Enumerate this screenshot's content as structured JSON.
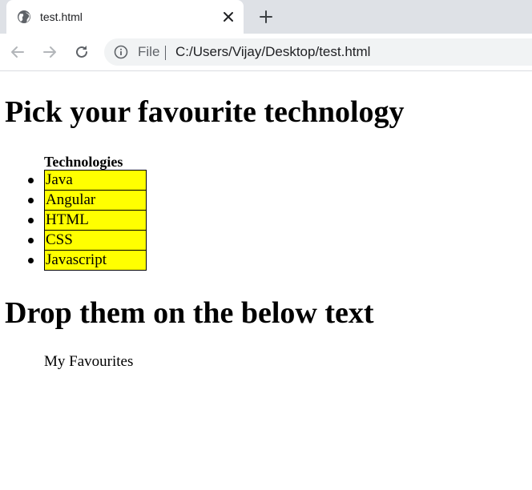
{
  "browser": {
    "tab": {
      "title": "test.html"
    },
    "address_bar": {
      "scheme_label": "File",
      "url": "C:/Users/Vijay/Desktop/test.html"
    }
  },
  "page": {
    "heading_pick": "Pick your favourite technology",
    "list_header": "Technologies",
    "technologies": [
      "Java",
      "Angular",
      "HTML",
      "CSS",
      "Javascript"
    ],
    "heading_drop": "Drop them on the below text",
    "drop_target_label": "My Favourites"
  },
  "colors": {
    "item_background": "#ffff00",
    "tabstrip_background": "#dee1e6",
    "omnibox_background": "#f1f3f4"
  }
}
